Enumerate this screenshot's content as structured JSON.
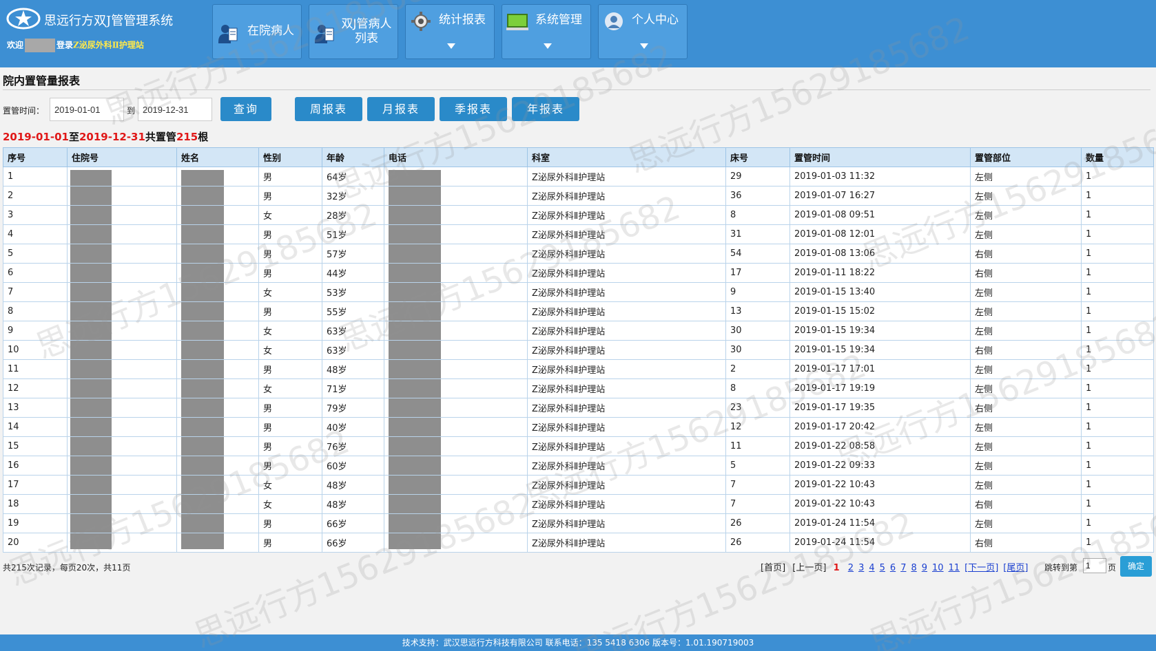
{
  "header": {
    "app_title": "思远行方双J管管理系统",
    "welcome_prefix": "欢迎",
    "welcome_login": "登录",
    "ward": "Z泌尿外科Ⅱ护理站",
    "nav": [
      {
        "label": "在院病人",
        "icon": "patient-icon"
      },
      {
        "label": "双J管病人\n列表",
        "icon": "patient-list-icon"
      },
      {
        "label": "统计报表",
        "icon": "gear-icon"
      },
      {
        "label": "系统管理",
        "icon": "monitor-icon"
      },
      {
        "label": "个人中心",
        "icon": "user-icon"
      }
    ]
  },
  "page": {
    "title": "院内置管量报表",
    "filter_label": "置管时间：",
    "to_label": "到",
    "start_date": "2019-01-01",
    "end_date": "2019-12-31",
    "query_button": "查询",
    "report_buttons": [
      "周报表",
      "月报表",
      "季报表",
      "年报表"
    ]
  },
  "summary": {
    "start": "2019-01-01",
    "to": "至",
    "end": "2019-12-31",
    "middle": "共置管",
    "count": "215",
    "unit": "根"
  },
  "table": {
    "headers": [
      "序号",
      "住院号",
      "姓名",
      "性别",
      "年龄",
      "电话",
      "科室",
      "床号",
      "置管时间",
      "置管部位",
      "数量"
    ],
    "rows": [
      [
        "1",
        "",
        "",
        "男",
        "64岁",
        "",
        "Z泌尿外科Ⅱ护理站",
        "29",
        "2019-01-03 11:32",
        "左侧",
        "1"
      ],
      [
        "2",
        "",
        "",
        "男",
        "32岁",
        "",
        "Z泌尿外科Ⅱ护理站",
        "36",
        "2019-01-07 16:27",
        "左侧",
        "1"
      ],
      [
        "3",
        "",
        "",
        "女",
        "28岁",
        "",
        "Z泌尿外科Ⅱ护理站",
        "8",
        "2019-01-08 09:51",
        "左侧",
        "1"
      ],
      [
        "4",
        "",
        "",
        "男",
        "51岁",
        "",
        "Z泌尿外科Ⅱ护理站",
        "31",
        "2019-01-08 12:01",
        "左侧",
        "1"
      ],
      [
        "5",
        "",
        "",
        "男",
        "57岁",
        "",
        "Z泌尿外科Ⅱ护理站",
        "54",
        "2019-01-08 13:06",
        "右侧",
        "1"
      ],
      [
        "6",
        "",
        "",
        "男",
        "44岁",
        "",
        "Z泌尿外科Ⅱ护理站",
        "17",
        "2019-01-11 18:22",
        "右侧",
        "1"
      ],
      [
        "7",
        "",
        "",
        "女",
        "53岁",
        "",
        "Z泌尿外科Ⅱ护理站",
        "9",
        "2019-01-15 13:40",
        "左侧",
        "1"
      ],
      [
        "8",
        "",
        "",
        "男",
        "55岁",
        "",
        "Z泌尿外科Ⅱ护理站",
        "13",
        "2019-01-15 15:02",
        "左侧",
        "1"
      ],
      [
        "9",
        "",
        "",
        "女",
        "63岁",
        "",
        "Z泌尿外科Ⅱ护理站",
        "30",
        "2019-01-15 19:34",
        "左侧",
        "1"
      ],
      [
        "10",
        "",
        "",
        "女",
        "63岁",
        "",
        "Z泌尿外科Ⅱ护理站",
        "30",
        "2019-01-15 19:34",
        "右侧",
        "1"
      ],
      [
        "11",
        "",
        "",
        "男",
        "48岁",
        "",
        "Z泌尿外科Ⅱ护理站",
        "2",
        "2019-01-17 17:01",
        "左侧",
        "1"
      ],
      [
        "12",
        "",
        "",
        "女",
        "71岁",
        "",
        "Z泌尿外科Ⅱ护理站",
        "8",
        "2019-01-17 19:19",
        "左侧",
        "1"
      ],
      [
        "13",
        "",
        "",
        "男",
        "79岁",
        "",
        "Z泌尿外科Ⅱ护理站",
        "23",
        "2019-01-17 19:35",
        "右侧",
        "1"
      ],
      [
        "14",
        "",
        "",
        "男",
        "40岁",
        "",
        "Z泌尿外科Ⅱ护理站",
        "12",
        "2019-01-17 20:42",
        "左侧",
        "1"
      ],
      [
        "15",
        "",
        "",
        "男",
        "76岁",
        "",
        "Z泌尿外科Ⅱ护理站",
        "11",
        "2019-01-22 08:58",
        "左侧",
        "1"
      ],
      [
        "16",
        "",
        "",
        "男",
        "60岁",
        "",
        "Z泌尿外科Ⅱ护理站",
        "5",
        "2019-01-22 09:33",
        "左侧",
        "1"
      ],
      [
        "17",
        "",
        "",
        "女",
        "48岁",
        "",
        "Z泌尿外科Ⅱ护理站",
        "7",
        "2019-01-22 10:43",
        "左侧",
        "1"
      ],
      [
        "18",
        "",
        "",
        "女",
        "48岁",
        "",
        "Z泌尿外科Ⅱ护理站",
        "7",
        "2019-01-22 10:43",
        "右侧",
        "1"
      ],
      [
        "19",
        "",
        "",
        "男",
        "66岁",
        "",
        "Z泌尿外科Ⅱ护理站",
        "26",
        "2019-01-24 11:54",
        "左侧",
        "1"
      ],
      [
        "20",
        "",
        "",
        "男",
        "66岁",
        "",
        "Z泌尿外科Ⅱ护理站",
        "26",
        "2019-01-24 11:54",
        "右侧",
        "1"
      ]
    ]
  },
  "pagination": {
    "records_text": "共215次记录，每页20次，共11页",
    "first": "[首页]",
    "prev": "[上一页]",
    "current": "1",
    "pages": [
      "2",
      "3",
      "4",
      "5",
      "6",
      "7",
      "8",
      "9",
      "10",
      "11"
    ],
    "next": "[下一页]",
    "last": "[尾页]",
    "jump_label": "跳转到第",
    "jump_value": "1",
    "page_suffix": "页",
    "ok_button": "确定"
  },
  "footer": {
    "text": "技术支持：武汉思远行方科技有限公司   联系电话：135 5418 6306   版本号：1.01.190719003"
  },
  "watermark": "思远行方15629185682",
  "colors": {
    "header_bg": "#3d8fd3",
    "button_bg": "#2a8ac9",
    "highlight_red": "#e01818",
    "ward_yellow": "#ffe94a"
  }
}
